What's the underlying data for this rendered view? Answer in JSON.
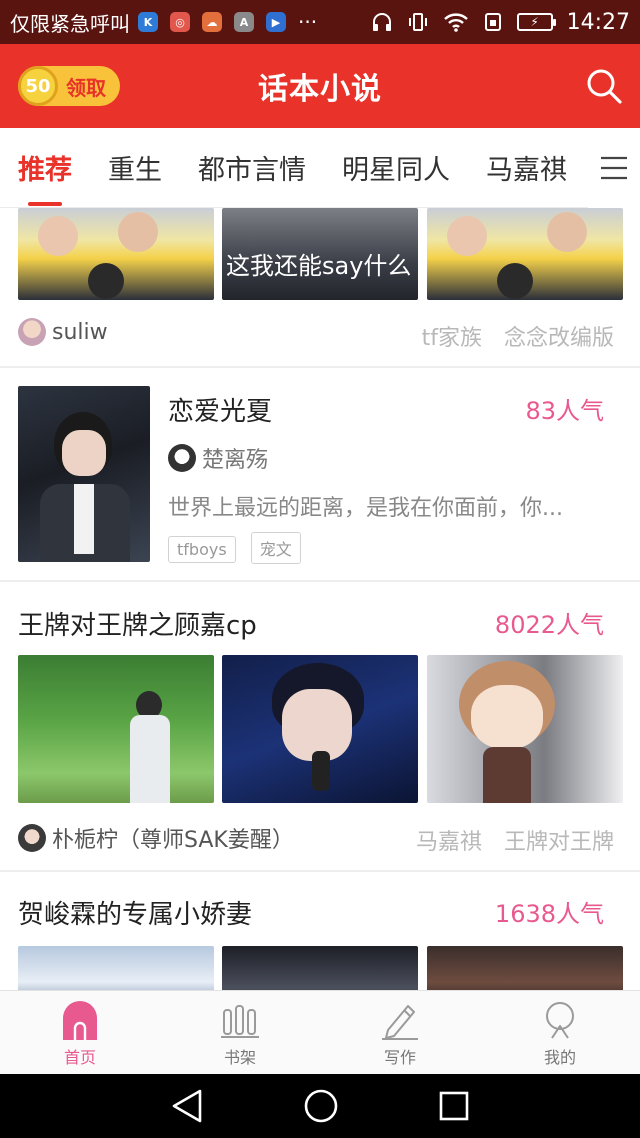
{
  "status_bar": {
    "notice": "仅限紧急呼叫",
    "apps": [
      {
        "name": "app-k-icon",
        "glyph": "K",
        "color": "#2f7bd8"
      },
      {
        "name": "app-game-icon",
        "glyph": "◎",
        "color": "#e2574c"
      },
      {
        "name": "app-cloud-icon",
        "glyph": "☁",
        "color": "#e26f3c"
      },
      {
        "name": "app-a-icon",
        "glyph": "A",
        "color": "#8a8a8a"
      },
      {
        "name": "app-play-icon",
        "glyph": "▶",
        "color": "#2e6fd1"
      }
    ],
    "more": "···",
    "time": "14:27"
  },
  "header": {
    "coin_value": "50",
    "coin_label": "领取",
    "title": "话本小说"
  },
  "tabs": [
    {
      "label": "推荐",
      "active": true
    },
    {
      "label": "重生",
      "active": false
    },
    {
      "label": "都市言情",
      "active": false
    },
    {
      "label": "明星同人",
      "active": false
    },
    {
      "label": "马嘉祺",
      "active": false
    }
  ],
  "feed": {
    "item1": {
      "author": "suliw",
      "tags": [
        "tf家族",
        "念念改编版"
      ],
      "image_caption": "这我还能say什么"
    },
    "item2": {
      "title": "恋爱光夏",
      "popularity": "83人气",
      "author": "楚离殇",
      "summary": "世界上最远的距离，是我在你面前，你...",
      "badges": [
        "tfboys",
        "宠文"
      ]
    },
    "item3": {
      "title": "王牌对王牌之顾嘉cp",
      "popularity": "8022人气",
      "author": "朴栀柠（尊师SAK姜醒）",
      "tags": [
        "马嘉祺",
        "王牌对王牌"
      ]
    },
    "item4": {
      "title": "贺峻霖的专属小娇妻",
      "popularity": "1638人气"
    }
  },
  "bottom_nav": [
    {
      "label": "首页",
      "icon": "home-icon",
      "active": true
    },
    {
      "label": "书架",
      "icon": "bookshelf-icon",
      "active": false
    },
    {
      "label": "写作",
      "icon": "pen-icon",
      "active": false
    },
    {
      "label": "我的",
      "icon": "profile-icon",
      "active": false
    }
  ],
  "colors": {
    "brand_red": "#e8322a",
    "popularity_pink": "#e85a8f",
    "status_bar": "#5a1410"
  }
}
